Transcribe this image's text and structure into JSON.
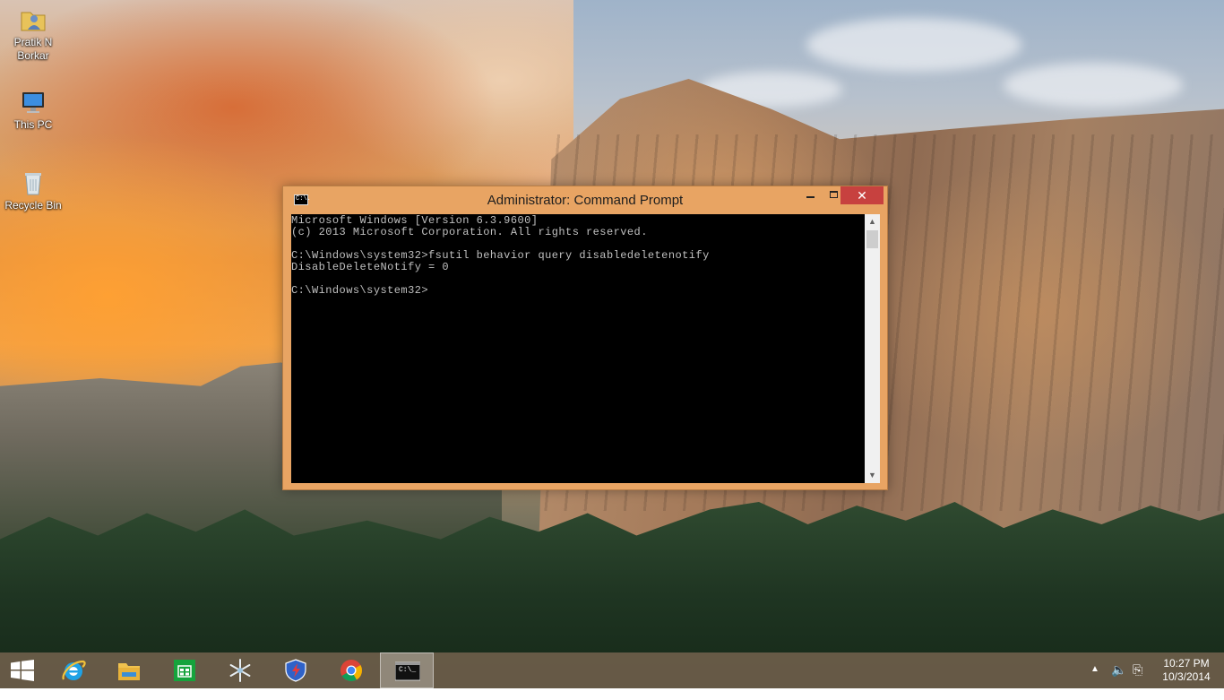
{
  "desktop": {
    "icons": [
      {
        "label": "Pratik N\nBorkar",
        "label_line1": "Pratik N",
        "label_line2": "Borkar",
        "icon": "user-folder-icon"
      },
      {
        "label": "This PC",
        "icon": "computer-icon"
      },
      {
        "label": "Recycle Bin",
        "icon": "recycle-bin-icon"
      }
    ]
  },
  "window": {
    "title": "Administrator: Command Prompt",
    "icon_text": "C:\\.",
    "close_glyph": "✕",
    "console_lines": [
      "Microsoft Windows [Version 6.3.9600]",
      "(c) 2013 Microsoft Corporation. All rights reserved.",
      "",
      "C:\\Windows\\system32>fsutil behavior query disabledeletenotify",
      "DisableDeleteNotify = 0",
      "",
      "C:\\Windows\\system32>"
    ]
  },
  "taskbar": {
    "items": [
      {
        "name": "start-button",
        "icon": "windows-logo-icon"
      },
      {
        "name": "internet-explorer",
        "icon": "internet-explorer-icon"
      },
      {
        "name": "file-explorer",
        "icon": "file-explorer-icon"
      },
      {
        "name": "store",
        "icon": "store-icon"
      },
      {
        "name": "snowflake-app",
        "icon": "snowflake-icon"
      },
      {
        "name": "shield-app",
        "icon": "shield-icon"
      },
      {
        "name": "chrome",
        "icon": "chrome-icon"
      },
      {
        "name": "command-prompt",
        "icon": "command-prompt-icon",
        "active": true
      }
    ],
    "cmd_icon_text": "C:\\_",
    "tray": {
      "arrow_glyph": "▲",
      "speaker_glyph": "🔈",
      "network_glyph": "⎘"
    },
    "clock": {
      "time": "10:27 PM",
      "date": "10/3/2014"
    }
  },
  "colors": {
    "window_frame": "#e8a463",
    "close_button": "#c7413f",
    "console_bg": "#000000",
    "console_text": "#c0c0c0"
  }
}
